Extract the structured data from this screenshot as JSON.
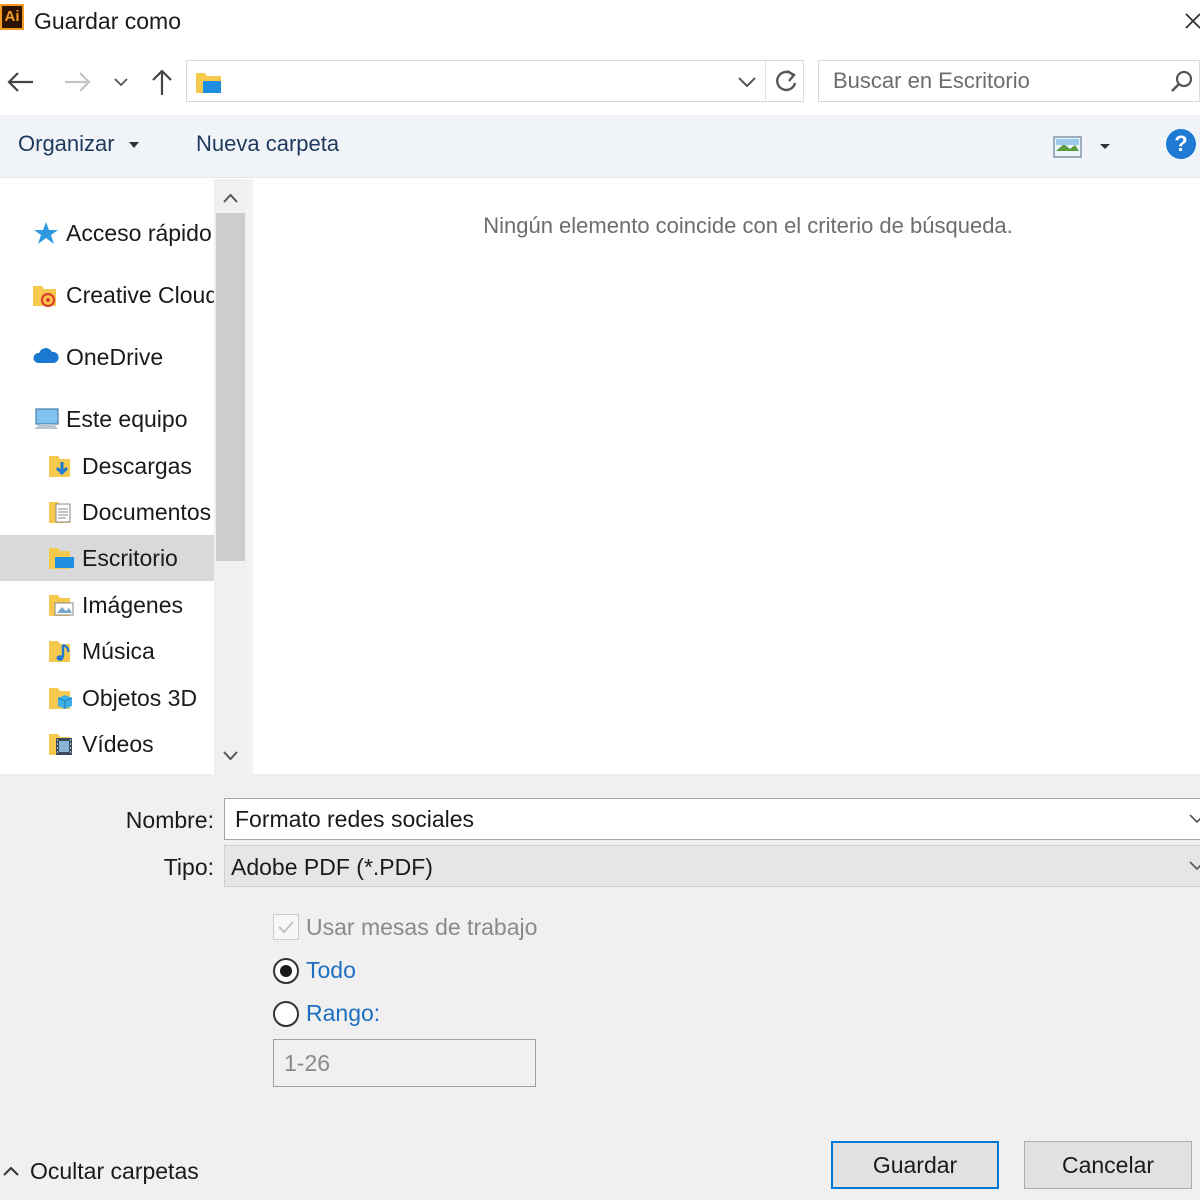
{
  "window": {
    "app_icon_text": "Ai",
    "title": "Guardar como"
  },
  "nav": {
    "search_placeholder": "Buscar en Escritorio"
  },
  "toolbar": {
    "organize_label": "Organizar",
    "new_folder_label": "Nueva carpeta",
    "help_label": "?"
  },
  "sidebar": {
    "items": [
      {
        "label": "Acceso rápido",
        "icon": "star-icon"
      },
      {
        "label": "Creative Cloud",
        "icon": "creative-cloud-folder-icon"
      },
      {
        "label": "OneDrive",
        "icon": "cloud-icon"
      },
      {
        "label": "Este equipo",
        "icon": "computer-icon"
      },
      {
        "label": "Descargas",
        "icon": "downloads-folder-icon"
      },
      {
        "label": "Documentos",
        "icon": "documents-folder-icon"
      },
      {
        "label": "Escritorio",
        "icon": "desktop-folder-icon",
        "selected": true
      },
      {
        "label": "Imágenes",
        "icon": "pictures-folder-icon"
      },
      {
        "label": "Música",
        "icon": "music-folder-icon"
      },
      {
        "label": "Objetos 3D",
        "icon": "3d-objects-folder-icon"
      },
      {
        "label": "Vídeos",
        "icon": "videos-folder-icon"
      }
    ]
  },
  "main": {
    "empty_message": "Ningún elemento coincide con el criterio de búsqueda."
  },
  "form": {
    "name_label": "Nombre:",
    "name_value": "Formato redes sociales",
    "type_label": "Tipo:",
    "type_value": "Adobe PDF (*.PDF)",
    "artboards_label": "Usar mesas de trabajo",
    "all_label": "Todo",
    "range_label": "Rango:",
    "range_value": "1-26"
  },
  "footer": {
    "hide_folders_label": "Ocultar carpetas",
    "save_label": "Guardar",
    "cancel_label": "Cancelar"
  },
  "colors": {
    "accent": "#0078d7",
    "link_blue": "#1f6fc1",
    "selection": "#d9d9d9",
    "toolbar_bg": "#f0f4f9",
    "panel_bg": "#f0f0f0"
  }
}
